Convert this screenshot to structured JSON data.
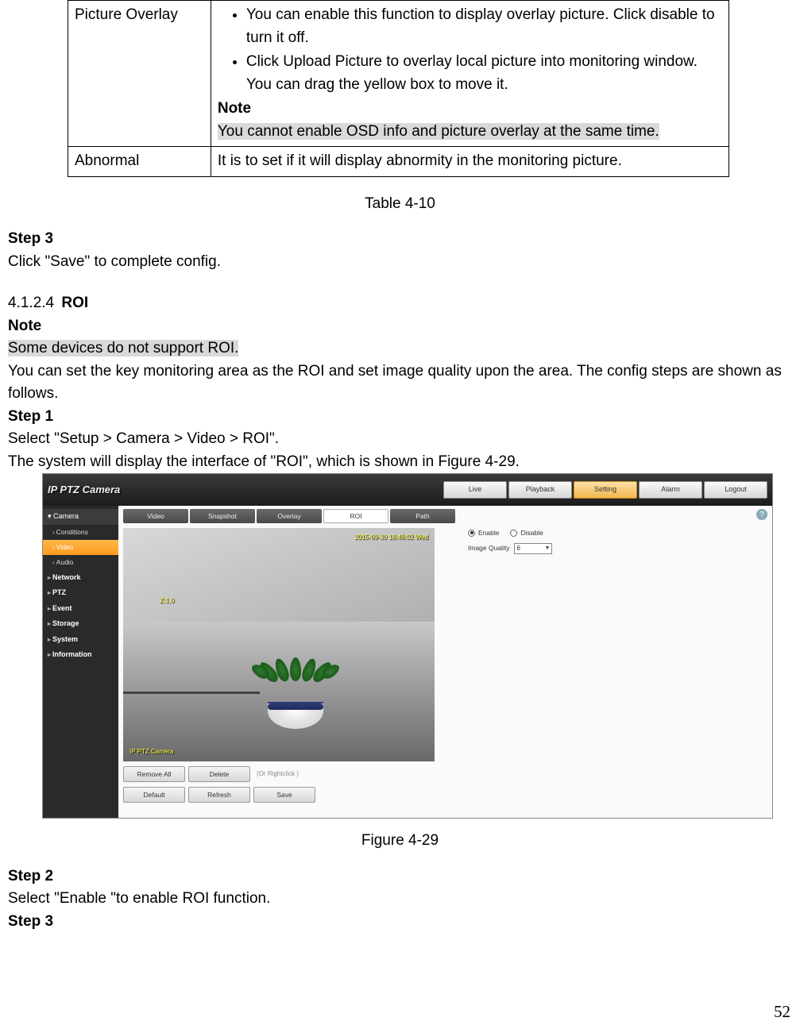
{
  "table": {
    "rows": [
      {
        "label": "Picture Overlay",
        "bullets": [
          "You can enable this function to display overlay picture. Click disable to turn it off.",
          "Click Upload Picture to overlay local picture into monitoring window. You can drag the yellow box to move it."
        ],
        "note_label": "Note",
        "note_text": "You cannot enable OSD info and picture overlay at the same time."
      },
      {
        "label": "Abnormal",
        "text": "It is to set if it will display abnormity in the monitoring picture."
      }
    ]
  },
  "table_caption": "Table 4-10",
  "steps_top": {
    "step3_label": "Step 3",
    "step3_text": "Click \"Save\" to complete config."
  },
  "section": {
    "num": "4.1.2.4",
    "title": "ROI",
    "note_label": "Note",
    "note_text": "Some devices do not support ROI.",
    "intro": "You can set the key monitoring area as the ROI and set image quality upon the area. The config steps are shown as follows.",
    "step1_label": "Step 1",
    "step1_text": "Select \"Setup > Camera > Video > ROI\".",
    "step1_text2": "The system will display the interface of \"ROI\", which is shown in Figure 4-29."
  },
  "screenshot": {
    "logo": "IP PTZ Camera",
    "top_buttons": [
      "Live",
      "Playback",
      "Setting",
      "Alarm",
      "Logout"
    ],
    "top_active_index": 2,
    "sidebar": {
      "header": "Camera",
      "items": [
        "Conditions",
        "Video",
        "Audio"
      ],
      "selected_index": 1,
      "groups": [
        "Network",
        "PTZ",
        "Event",
        "Storage",
        "System",
        "Information"
      ]
    },
    "tabs": [
      "Video",
      "Snapshot",
      "Overlay",
      "ROI",
      "Path"
    ],
    "tab_active_index": 3,
    "video": {
      "osd_top": "2015-09-30 16:46:02 Wed",
      "osd_zoom": "Z:1.0",
      "osd_bottom": "IP PTZ Camera"
    },
    "row1": {
      "remove_all": "Remove All",
      "delete": "Delete",
      "hint": "(Or Rightclick )"
    },
    "row2": {
      "default": "Default",
      "refresh": "Refresh",
      "save": "Save"
    },
    "right": {
      "enable": "Enable",
      "disable": "Disable",
      "radio_selected": "enable",
      "image_quality_label": "Image Quality",
      "image_quality_value": "6"
    },
    "help_icon": "?"
  },
  "figure_caption": "Figure 4-29",
  "steps_bottom": {
    "step2_label": "Step 2",
    "step2_text": "Select \"Enable \"to enable ROI function.",
    "step3_label": "Step 3"
  },
  "page_number": "52"
}
